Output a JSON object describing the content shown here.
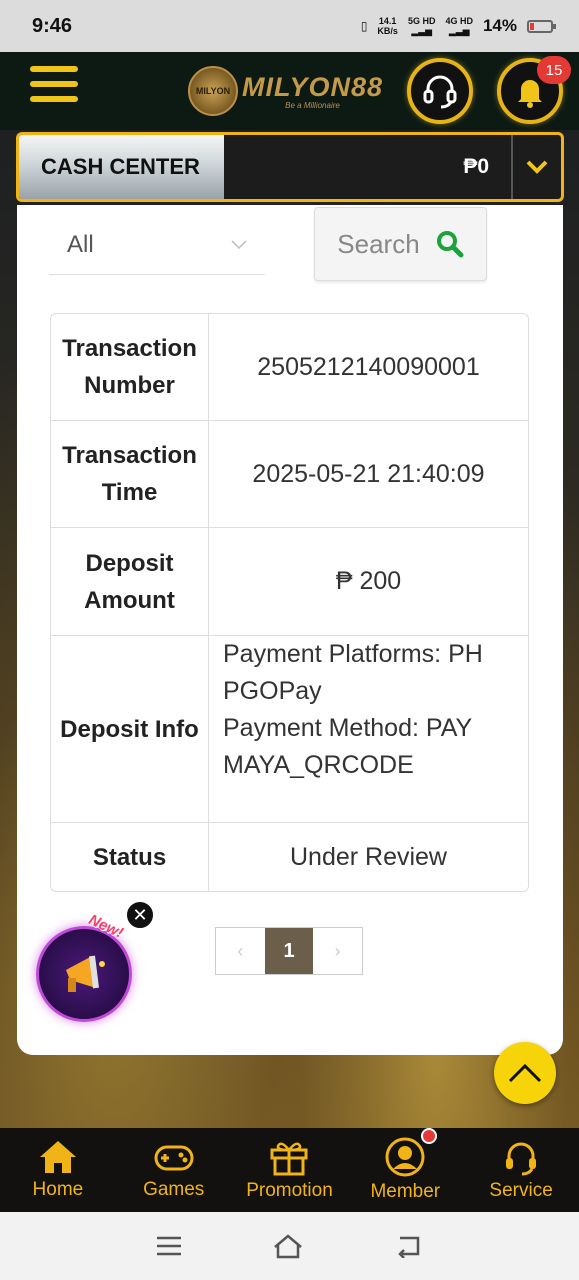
{
  "status_bar": {
    "time": "9:46",
    "speed_value": "14.1",
    "speed_unit": "KB/s",
    "signal1": "5G HD",
    "signal2": "4G HD",
    "battery": "14%"
  },
  "header": {
    "logo_text": "MILYON88",
    "logo_tagline": "Be a Millionaire",
    "logo_emblem_text": "MILYON",
    "notification_count": "15"
  },
  "cash_center": {
    "label": "CASH CENTER",
    "balance": "₱0"
  },
  "filter": {
    "selected": "All",
    "search_label": "Search"
  },
  "details": {
    "rows": [
      {
        "key": "Transaction Number",
        "value": "2505212140090001"
      },
      {
        "key": "Transaction Time",
        "value": "2025-05-21 21:40:09"
      },
      {
        "key": "Deposit Amount",
        "value": "₱ 200"
      },
      {
        "key": "Deposit Info",
        "value_line1": "Payment Platforms: PH PGOPay",
        "value_line2": "Payment Method: PAY MAYA_QRCODE"
      },
      {
        "key": "Status",
        "value": "Under Review"
      }
    ]
  },
  "pagination": {
    "prev": "‹",
    "current": "1",
    "next": "›"
  },
  "promo": {
    "new_label": "New!",
    "close": "✕"
  },
  "bottom_nav": {
    "items": [
      {
        "label": "Home"
      },
      {
        "label": "Games"
      },
      {
        "label": "Promotion"
      },
      {
        "label": "Member"
      },
      {
        "label": "Service"
      }
    ]
  },
  "colors": {
    "accent": "#f0b417",
    "header_bg": "#0d1a14",
    "badge": "#e53935",
    "search_icon": "#1aa33a"
  }
}
